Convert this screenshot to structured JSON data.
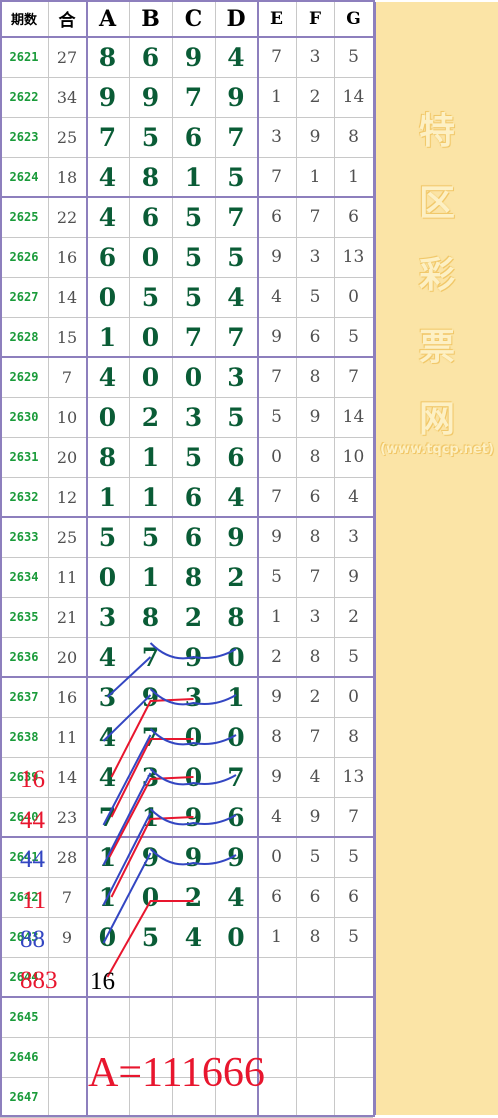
{
  "header": {
    "issue_label": "期数",
    "sum_label": "合",
    "columns": [
      "A",
      "B",
      "C",
      "D",
      "E",
      "F",
      "G"
    ]
  },
  "rows": [
    {
      "issue": "2621",
      "sum": "27",
      "abcd": [
        "8",
        "6",
        "9",
        "4"
      ],
      "efg": [
        "7",
        "3",
        "5"
      ]
    },
    {
      "issue": "2622",
      "sum": "34",
      "abcd": [
        "9",
        "9",
        "7",
        "9"
      ],
      "efg": [
        "1",
        "2",
        "14"
      ]
    },
    {
      "issue": "2623",
      "sum": "25",
      "abcd": [
        "7",
        "5",
        "6",
        "7"
      ],
      "efg": [
        "3",
        "9",
        "8"
      ]
    },
    {
      "issue": "2624",
      "sum": "18",
      "abcd": [
        "4",
        "8",
        "1",
        "5"
      ],
      "efg": [
        "7",
        "1",
        "1"
      ]
    },
    {
      "issue": "2625",
      "sum": "22",
      "abcd": [
        "4",
        "6",
        "5",
        "7"
      ],
      "efg": [
        "6",
        "7",
        "6"
      ]
    },
    {
      "issue": "2626",
      "sum": "16",
      "abcd": [
        "6",
        "0",
        "5",
        "5"
      ],
      "efg": [
        "9",
        "3",
        "13"
      ]
    },
    {
      "issue": "2627",
      "sum": "14",
      "abcd": [
        "0",
        "5",
        "5",
        "4"
      ],
      "efg": [
        "4",
        "5",
        "0"
      ]
    },
    {
      "issue": "2628",
      "sum": "15",
      "abcd": [
        "1",
        "0",
        "7",
        "7"
      ],
      "efg": [
        "9",
        "6",
        "5"
      ]
    },
    {
      "issue": "2629",
      "sum": "7",
      "abcd": [
        "4",
        "0",
        "0",
        "3"
      ],
      "efg": [
        "7",
        "8",
        "7"
      ]
    },
    {
      "issue": "2630",
      "sum": "10",
      "abcd": [
        "0",
        "2",
        "3",
        "5"
      ],
      "efg": [
        "5",
        "9",
        "14"
      ]
    },
    {
      "issue": "2631",
      "sum": "20",
      "abcd": [
        "8",
        "1",
        "5",
        "6"
      ],
      "efg": [
        "0",
        "8",
        "10"
      ]
    },
    {
      "issue": "2632",
      "sum": "12",
      "abcd": [
        "1",
        "1",
        "6",
        "4"
      ],
      "efg": [
        "7",
        "6",
        "4"
      ]
    },
    {
      "issue": "2633",
      "sum": "25",
      "abcd": [
        "5",
        "5",
        "6",
        "9"
      ],
      "efg": [
        "9",
        "8",
        "3"
      ]
    },
    {
      "issue": "2634",
      "sum": "11",
      "abcd": [
        "0",
        "1",
        "8",
        "2"
      ],
      "efg": [
        "5",
        "7",
        "9"
      ]
    },
    {
      "issue": "2635",
      "sum": "21",
      "abcd": [
        "3",
        "8",
        "2",
        "8"
      ],
      "efg": [
        "1",
        "3",
        "2"
      ]
    },
    {
      "issue": "2636",
      "sum": "20",
      "abcd": [
        "4",
        "7",
        "9",
        "0"
      ],
      "efg": [
        "2",
        "8",
        "5"
      ]
    },
    {
      "issue": "2637",
      "sum": "16",
      "abcd": [
        "3",
        "9",
        "3",
        "1"
      ],
      "efg": [
        "9",
        "2",
        "0"
      ]
    },
    {
      "issue": "2638",
      "sum": "11",
      "abcd": [
        "4",
        "7",
        "0",
        "0"
      ],
      "efg": [
        "8",
        "7",
        "8"
      ]
    },
    {
      "issue": "2639",
      "sum": "14",
      "abcd": [
        "4",
        "3",
        "0",
        "7"
      ],
      "efg": [
        "9",
        "4",
        "13"
      ]
    },
    {
      "issue": "2640",
      "sum": "23",
      "abcd": [
        "7",
        "1",
        "9",
        "6"
      ],
      "efg": [
        "4",
        "9",
        "7"
      ]
    },
    {
      "issue": "2641",
      "sum": "28",
      "abcd": [
        "1",
        "9",
        "9",
        "9"
      ],
      "efg": [
        "0",
        "5",
        "5"
      ]
    },
    {
      "issue": "2642",
      "sum": "7",
      "abcd": [
        "1",
        "0",
        "2",
        "4"
      ],
      "efg": [
        "6",
        "6",
        "6"
      ]
    },
    {
      "issue": "2643",
      "sum": "9",
      "abcd": [
        "0",
        "5",
        "4",
        "0"
      ],
      "efg": [
        "1",
        "8",
        "5"
      ]
    },
    {
      "issue": "2644",
      "sum": "",
      "abcd": [
        "",
        "",
        "",
        ""
      ],
      "efg": [
        "",
        "",
        ""
      ]
    },
    {
      "issue": "2645",
      "sum": "",
      "abcd": [
        "",
        "",
        "",
        ""
      ],
      "efg": [
        "",
        "",
        ""
      ]
    },
    {
      "issue": "2646",
      "sum": "",
      "abcd": [
        "",
        "",
        "",
        ""
      ],
      "efg": [
        "",
        "",
        ""
      ]
    },
    {
      "issue": "2647",
      "sum": "",
      "abcd": [
        "",
        "",
        "",
        ""
      ],
      "efg": [
        "",
        "",
        ""
      ]
    }
  ],
  "annotations": {
    "left_labels": [
      {
        "text": "16",
        "color": "#e8162e",
        "row": 18
      },
      {
        "text": "44",
        "color": "#e8162e",
        "row": 19
      },
      {
        "text": "44",
        "color": "#3346c2",
        "row": 20
      },
      {
        "text": "11",
        "color": "#e8162e",
        "row": 21
      },
      {
        "text": "88",
        "color": "#3346c2",
        "row": 22
      },
      {
        "text": "883",
        "color": "#e8162e",
        "row": 23
      }
    ],
    "next_value": {
      "text": "16",
      "color": "#000000"
    },
    "prediction": {
      "text": "A=111666",
      "color": "#e8162e"
    }
  },
  "colors": {
    "grid_line": "#c8c8c8",
    "group_line": "#8d7fbd",
    "issue_text": "#1a9b3a",
    "main_digits": "#0a5c36",
    "side_panel": "#fbe4a6",
    "line_red": "#e8162e",
    "line_blue": "#3346c2"
  },
  "watermark": {
    "chars": [
      "特",
      "区",
      "彩",
      "票",
      "网"
    ],
    "url": "(www.tqcp.net)"
  }
}
